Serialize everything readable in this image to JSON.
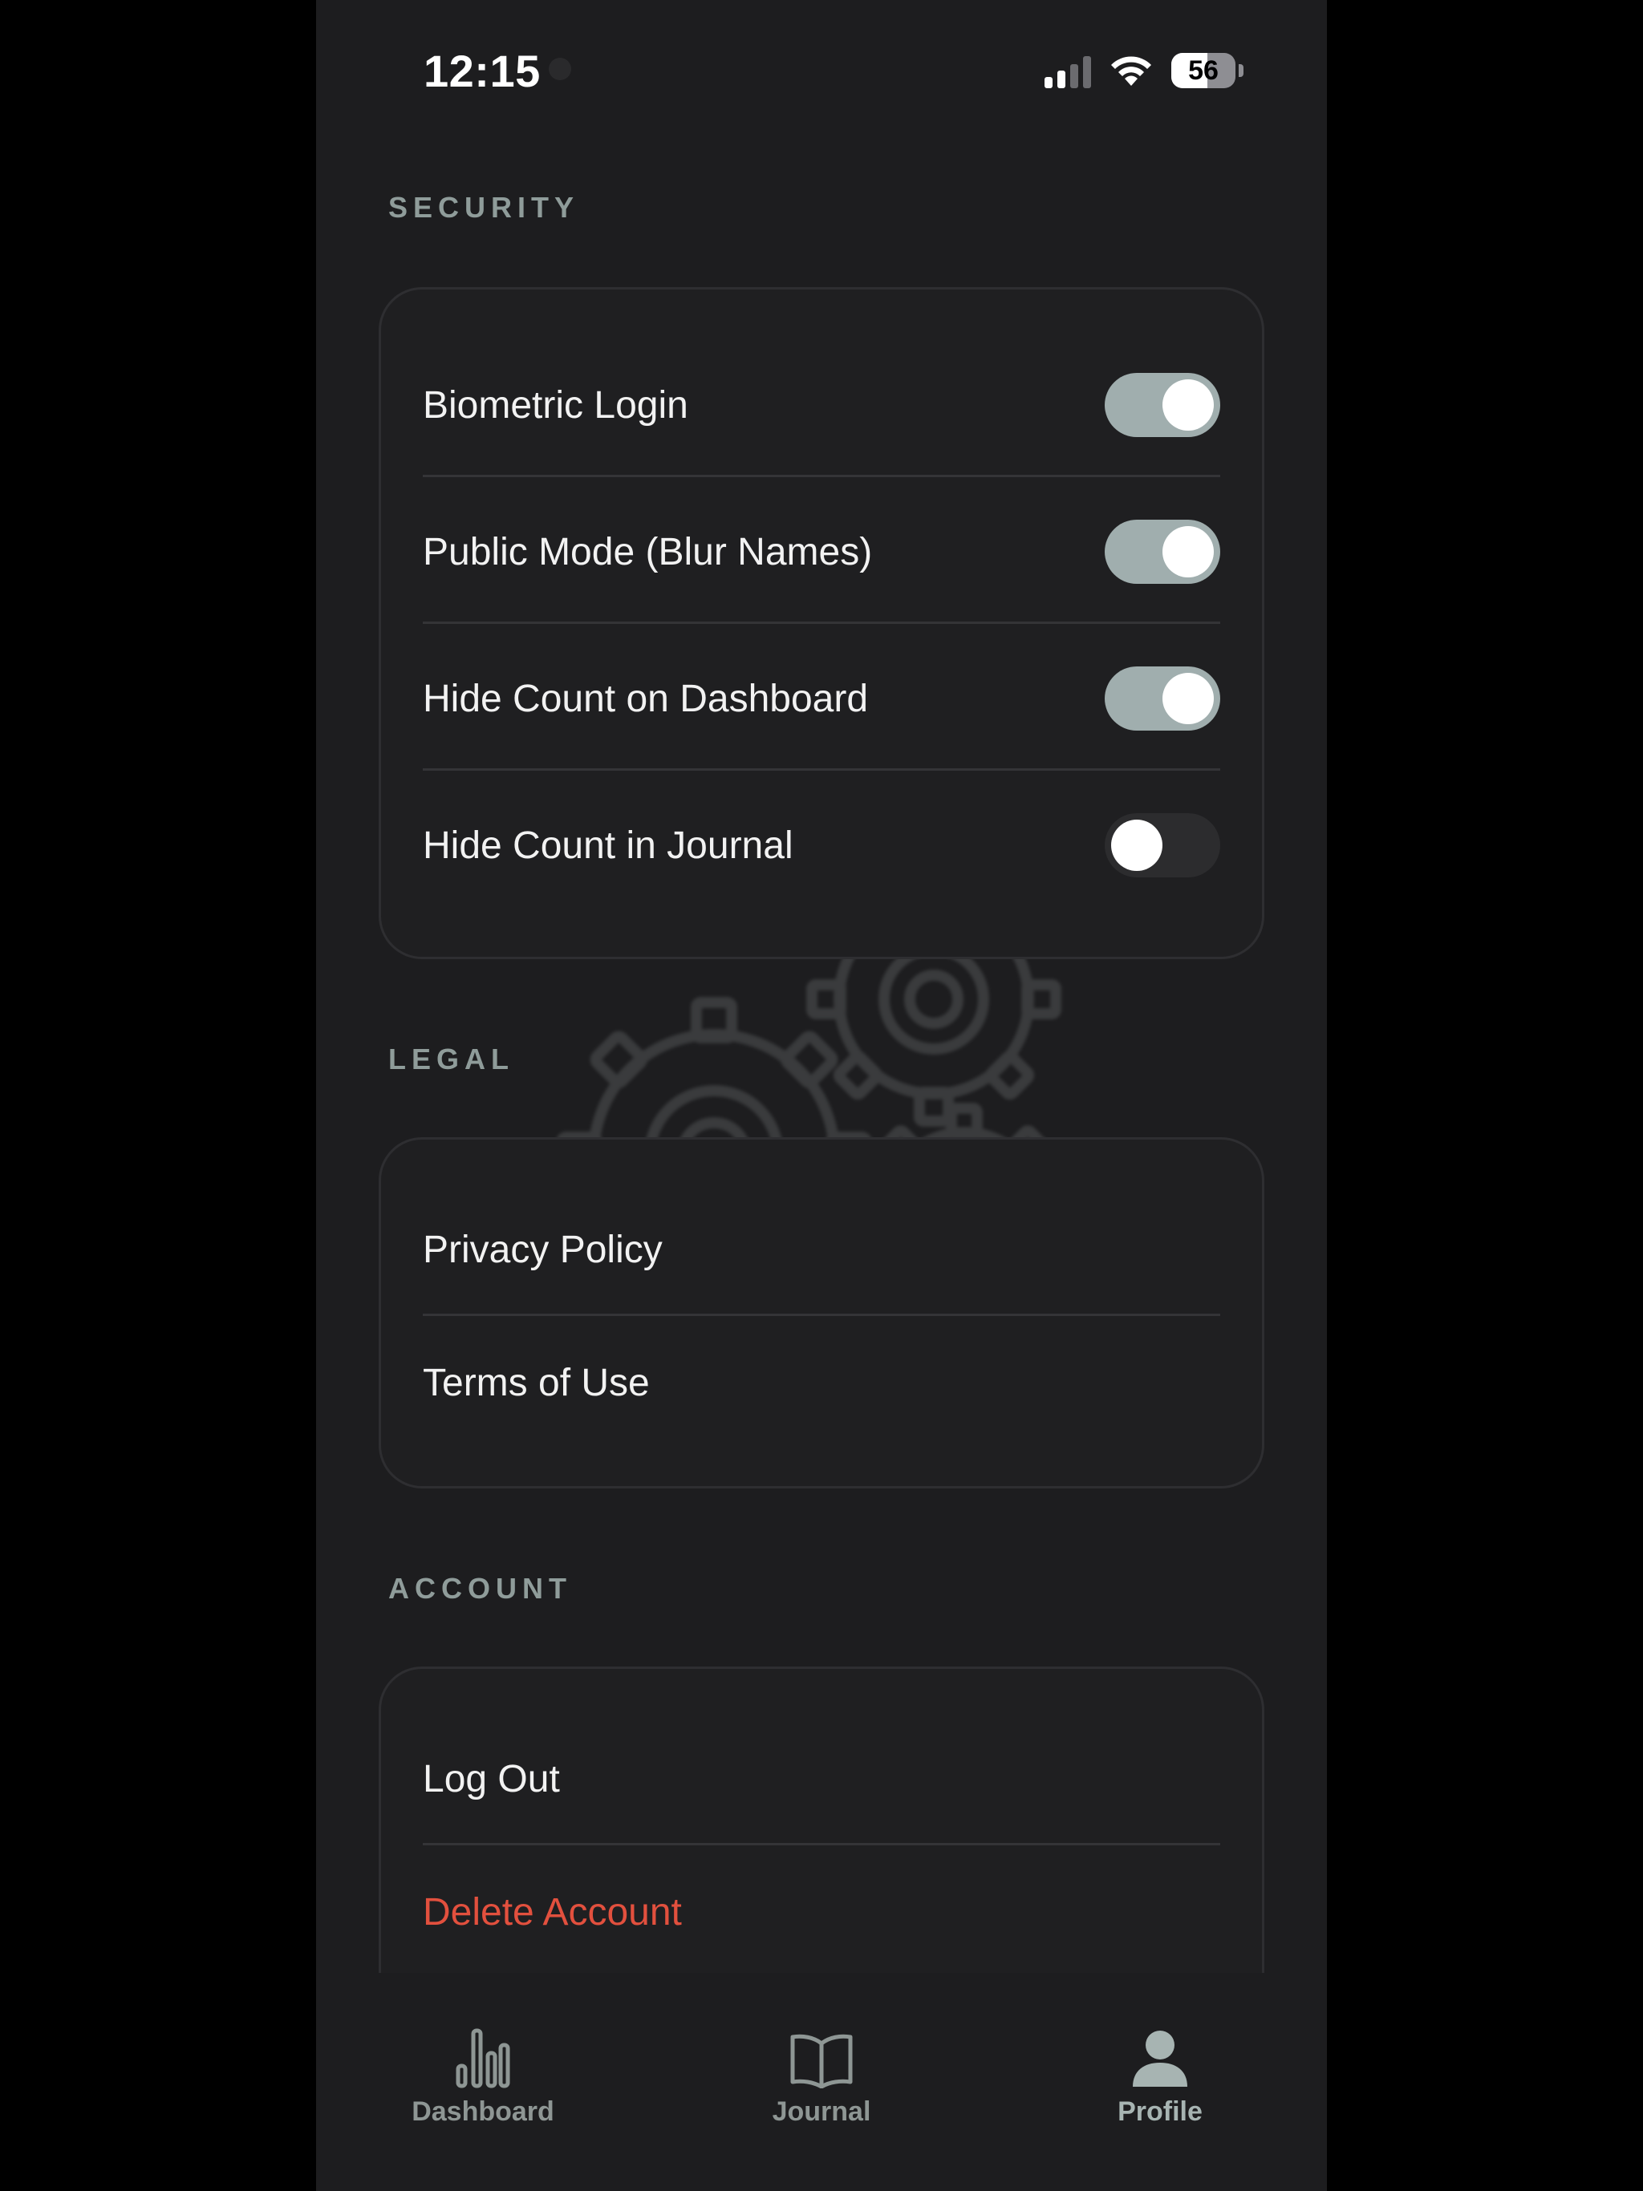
{
  "status_bar": {
    "time": "12:15",
    "battery_level": "56"
  },
  "colors": {
    "background": "#1d1d1f",
    "card": "#1f1f21",
    "toggle_on": "#a0aeae",
    "toggle_off": "#2c2c2e",
    "section_title": "#8f9c9a",
    "danger": "#e2503e"
  },
  "security": {
    "title": "SECURITY",
    "items": [
      {
        "label": "Biometric Login",
        "enabled": true
      },
      {
        "label": "Public Mode (Blur Names)",
        "enabled": true
      },
      {
        "label": "Hide Count on Dashboard",
        "enabled": true
      },
      {
        "label": "Hide Count in Journal",
        "enabled": false
      }
    ]
  },
  "legal": {
    "title": "LEGAL",
    "items": [
      {
        "label": "Privacy Policy"
      },
      {
        "label": "Terms of Use"
      }
    ]
  },
  "account": {
    "title": "ACCOUNT",
    "items": [
      {
        "label": "Log Out"
      },
      {
        "label": "Delete Account"
      }
    ]
  },
  "tabbar": {
    "active": "Profile",
    "tabs": [
      {
        "label": "Dashboard",
        "icon": "bar-chart-icon"
      },
      {
        "label": "Journal",
        "icon": "book-icon"
      },
      {
        "label": "Profile",
        "icon": "person-icon"
      }
    ]
  }
}
